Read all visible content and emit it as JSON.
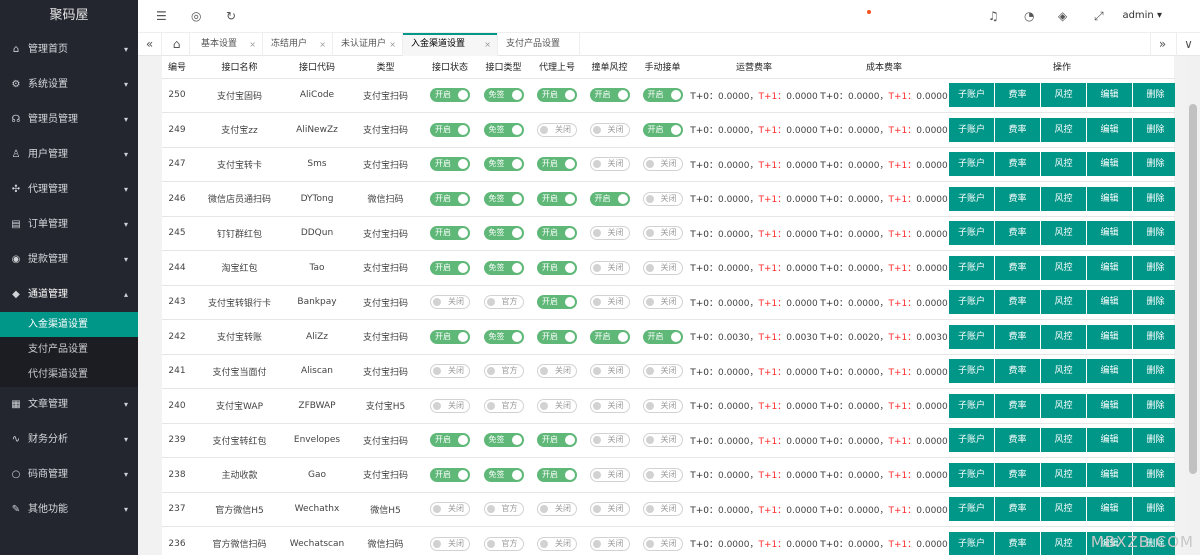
{
  "app": {
    "logo": "聚码屋"
  },
  "sidebar": {
    "items": [
      {
        "label": "管理首页",
        "icon": "home-icon",
        "glyph": "⌂",
        "caret": "▾"
      },
      {
        "label": "系统设置",
        "icon": "gear-icon",
        "glyph": "⚙",
        "caret": "▾"
      },
      {
        "label": "管理员管理",
        "icon": "headset-icon",
        "glyph": "☊",
        "caret": "▾"
      },
      {
        "label": "用户管理",
        "icon": "user-icon",
        "glyph": "♙",
        "caret": "▾"
      },
      {
        "label": "代理管理",
        "icon": "network-icon",
        "glyph": "✣",
        "caret": "▾"
      },
      {
        "label": "订单管理",
        "icon": "order-icon",
        "glyph": "▤",
        "caret": "▾"
      },
      {
        "label": "提款管理",
        "icon": "withdraw-icon",
        "glyph": "◉",
        "caret": "▾"
      },
      {
        "label": "通道管理",
        "icon": "diamond-icon",
        "glyph": "◆",
        "caret": "▴"
      },
      {
        "label": "文章管理",
        "icon": "article-icon",
        "glyph": "▦",
        "caret": "▾"
      },
      {
        "label": "财务分析",
        "icon": "pulse-icon",
        "glyph": "∿",
        "caret": "▾"
      },
      {
        "label": "码商管理",
        "icon": "circle-icon",
        "glyph": "○",
        "caret": "▾"
      },
      {
        "label": "其他功能",
        "icon": "edit-icon",
        "glyph": "✎",
        "caret": "▾"
      }
    ],
    "sub_items": [
      "入金渠道设置",
      "支付产品设置",
      "代付渠道设置"
    ]
  },
  "header": {
    "menu_icon": "☰",
    "globe_icon": "◎",
    "refresh_icon": "↻",
    "bell_icon": "♫",
    "theme_icon": "◔",
    "tag_icon": "◈",
    "fullscreen_icon": "⤢",
    "user": "admin",
    "user_caret": "▾"
  },
  "tabs": {
    "prev": "«",
    "home": "⌂",
    "next": "»",
    "more": "∨",
    "close": "×",
    "items": [
      "基本设置",
      "冻结用户",
      "未认证用户",
      "入金渠道设置",
      "支付产品设置"
    ],
    "active": 3
  },
  "table": {
    "headers": [
      "编号",
      "接口名称",
      "接口代码",
      "类型",
      "接口状态",
      "接口类型",
      "代理上号",
      "撞单风控",
      "手动接单",
      "运营费率",
      "成本费率",
      "操作"
    ],
    "op_labels": [
      "子账户",
      "费率",
      "风控",
      "编辑",
      "删除"
    ],
    "switch_labels": {
      "on": "开启",
      "off": "关闭",
      "free": "免签",
      "official": "官方"
    },
    "fee_labels": {
      "t0": "T+0：",
      "t1": "T+1："
    },
    "rows": [
      {
        "id": "250",
        "name": "支付宝固码",
        "code": "AliCode",
        "type": "支付宝扫码",
        "status": true,
        "free": true,
        "agent": true,
        "risk": true,
        "manual": true,
        "op_t0": "0.0000",
        "op_t1": "0.0000",
        "cost_t0": "0.0000",
        "cost_t1": "0.0000"
      },
      {
        "id": "249",
        "name": "支付宝zz",
        "code": "AliNewZz",
        "type": "支付宝扫码",
        "status": true,
        "free": true,
        "agent": false,
        "risk": false,
        "manual": true,
        "op_t0": "0.0000",
        "op_t1": "0.0000",
        "cost_t0": "0.0000",
        "cost_t1": "0.0000"
      },
      {
        "id": "247",
        "name": "支付宝转卡",
        "code": "Sms",
        "type": "支付宝扫码",
        "status": true,
        "free": true,
        "agent": true,
        "risk": false,
        "manual": false,
        "op_t0": "0.0000",
        "op_t1": "0.0000",
        "cost_t0": "0.0000",
        "cost_t1": "0.0000"
      },
      {
        "id": "246",
        "name": "微信店员通扫码",
        "code": "DYTong",
        "type": "微信扫码",
        "status": true,
        "free": true,
        "agent": true,
        "risk": true,
        "manual": false,
        "op_t0": "0.0000",
        "op_t1": "0.0000",
        "cost_t0": "0.0000",
        "cost_t1": "0.0000"
      },
      {
        "id": "245",
        "name": "钉钉群红包",
        "code": "DDQun",
        "type": "支付宝扫码",
        "status": true,
        "free": true,
        "agent": true,
        "risk": false,
        "manual": false,
        "op_t0": "0.0000",
        "op_t1": "0.0000",
        "cost_t0": "0.0000",
        "cost_t1": "0.0000"
      },
      {
        "id": "244",
        "name": "淘宝红包",
        "code": "Tao",
        "type": "支付宝扫码",
        "status": true,
        "free": true,
        "agent": true,
        "risk": false,
        "manual": false,
        "op_t0": "0.0000",
        "op_t1": "0.0000",
        "cost_t0": "0.0000",
        "cost_t1": "0.0000"
      },
      {
        "id": "243",
        "name": "支付宝转银行卡",
        "code": "Bankpay",
        "type": "支付宝扫码",
        "status": false,
        "free": false,
        "agent": true,
        "risk": false,
        "manual": false,
        "op_t0": "0.0000",
        "op_t1": "0.0000",
        "cost_t0": "0.0000",
        "cost_t1": "0.0000"
      },
      {
        "id": "242",
        "name": "支付宝转账",
        "code": "AliZz",
        "type": "支付宝扫码",
        "status": true,
        "free": true,
        "agent": true,
        "risk": true,
        "manual": true,
        "op_t0": "0.0030",
        "op_t1": "0.0030",
        "cost_t0": "0.0020",
        "cost_t1": "0.0030"
      },
      {
        "id": "241",
        "name": "支付宝当面付",
        "code": "Aliscan",
        "type": "支付宝扫码",
        "status": false,
        "free": false,
        "agent": false,
        "risk": false,
        "manual": false,
        "op_t0": "0.0000",
        "op_t1": "0.0000",
        "cost_t0": "0.0000",
        "cost_t1": "0.0000"
      },
      {
        "id": "240",
        "name": "支付宝WAP",
        "code": "ZFBWAP",
        "type": "支付宝H5",
        "status": false,
        "free": false,
        "agent": false,
        "risk": false,
        "manual": false,
        "op_t0": "0.0000",
        "op_t1": "0.0000",
        "cost_t0": "0.0000",
        "cost_t1": "0.0000"
      },
      {
        "id": "239",
        "name": "支付宝转红包",
        "code": "Envelopes",
        "type": "支付宝扫码",
        "status": true,
        "free": true,
        "agent": true,
        "risk": false,
        "manual": false,
        "op_t0": "0.0000",
        "op_t1": "0.0000",
        "cost_t0": "0.0000",
        "cost_t1": "0.0000"
      },
      {
        "id": "238",
        "name": "主动收款",
        "code": "Gao",
        "type": "支付宝扫码",
        "status": true,
        "free": true,
        "agent": true,
        "risk": false,
        "manual": false,
        "op_t0": "0.0000",
        "op_t1": "0.0000",
        "cost_t0": "0.0000",
        "cost_t1": "0.0000"
      },
      {
        "id": "237",
        "name": "官方微信H5",
        "code": "Wechathx",
        "type": "微信H5",
        "status": false,
        "free": false,
        "agent": false,
        "risk": false,
        "manual": false,
        "op_t0": "0.0000",
        "op_t1": "0.0000",
        "cost_t0": "0.0000",
        "cost_t1": "0.0000"
      },
      {
        "id": "236",
        "name": "官方微信扫码",
        "code": "Wechatscan",
        "type": "微信扫码",
        "status": false,
        "free": false,
        "agent": false,
        "risk": false,
        "manual": false,
        "op_t0": "0.0000",
        "op_t1": "0.0000",
        "cost_t0": "0.0000",
        "cost_t1": "0.0000"
      }
    ]
  },
  "watermark": "MBXZB.COM",
  "colors": {
    "accent": "#009688",
    "switch_on": "#5fb878",
    "sidebar_bg": "#23262e",
    "fee_t1": "#ff2b2b"
  }
}
